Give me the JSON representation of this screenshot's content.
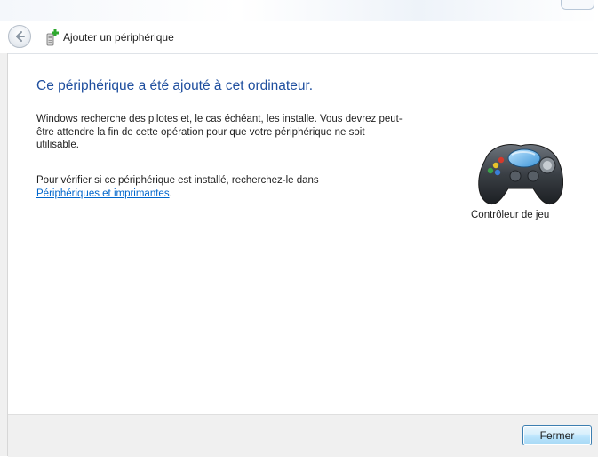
{
  "window": {
    "title": "Ajouter un périphérique"
  },
  "main": {
    "heading": "Ce périphérique a été ajouté à cet ordinateur.",
    "paragraph1": "Windows recherche des pilotes et, le cas échéant, les installe. Vous devrez peut-être attendre la fin de cette opération pour que votre périphérique ne soit utilisable.",
    "paragraph2_prefix": "Pour vérifier si ce périphérique est installé, recherchez-le dans",
    "paragraph2_link": "Périphériques et imprimantes",
    "paragraph2_suffix": "."
  },
  "device": {
    "label": "Contrôleur de jeu",
    "icon": "gamepad-icon"
  },
  "footer": {
    "close_label": "Fermer"
  },
  "colors": {
    "heading": "#1e4e9e",
    "link": "#0066cc",
    "footer_bg": "#f0f0f0",
    "button_border": "#3c7fb1"
  }
}
